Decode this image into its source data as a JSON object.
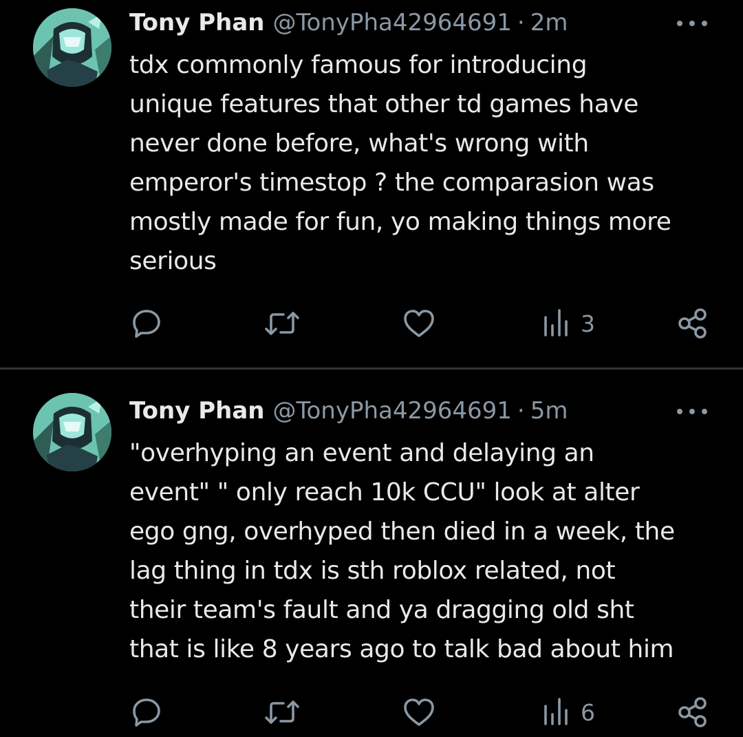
{
  "colors": {
    "background": "#000000",
    "text_primary": "#e7e9ea",
    "text_secondary": "#8b98a5",
    "divider": "#2f3336"
  },
  "icons": {
    "reply": "speech-bubble-icon",
    "repost": "repost-arrows-icon",
    "like": "heart-icon",
    "views": "bar-chart-icon",
    "share": "share-nodes-icon",
    "more": "more-dots-icon"
  },
  "tweets": [
    {
      "display_name": "Tony Phan",
      "handle": "@TonyPha42964691",
      "separator": "·",
      "time": "2m",
      "text": "tdx commonly famous for introducing\nunique features that other td games have\nnever done before, what's wrong with\nemperor's timestop ? the comparasion was\nmostly made for fun, yo making things more\nserious",
      "views": "3"
    },
    {
      "display_name": "Tony Phan",
      "handle": "@TonyPha42964691",
      "separator": "·",
      "time": "5m",
      "text": "\"overhyping an event and delaying an\nevent\" \" only reach 10k CCU\" look at alter\nego gng, overhyped then died in a week, the\nlag thing in tdx is sth roblox related, not\ntheir team's fault and ya dragging old sht\nthat is like 8 years ago to talk bad about him",
      "views": "6"
    }
  ]
}
